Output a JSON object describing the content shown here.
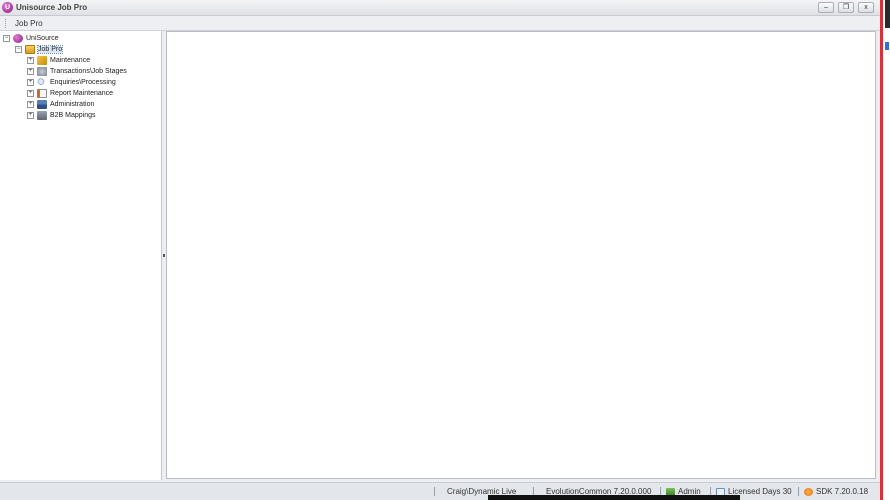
{
  "window": {
    "title": "Unisource Job Pro",
    "controls": {
      "minimize": "–",
      "restore": "❐",
      "close": "x"
    }
  },
  "menu": {
    "items": [
      "Job Pro"
    ]
  },
  "tree": {
    "root": "UniSource",
    "child": "Job Pro",
    "items": [
      {
        "label": "Maintenance",
        "icon": "key-icon"
      },
      {
        "label": "Transactions\\Job Stages",
        "icon": "gears-icon"
      },
      {
        "label": "Enquiries\\Processing",
        "icon": "magnifier-icon"
      },
      {
        "label": "Report Maintenance",
        "icon": "report-icon"
      },
      {
        "label": "Administration",
        "icon": "admin-icon"
      },
      {
        "label": "B2B Mappings",
        "icon": "b2b-icon"
      }
    ]
  },
  "status": {
    "connection": "Craig\\Dynamic Live",
    "common": "EvolutionCommon 7.20.0.000",
    "user": "Admin",
    "licensed_days": "Licensed Days 30",
    "sdk": "SDK 7.20.0.18"
  },
  "colors": {
    "accent_red": "#d8303a",
    "brand_purple": "#8a1b7c"
  }
}
